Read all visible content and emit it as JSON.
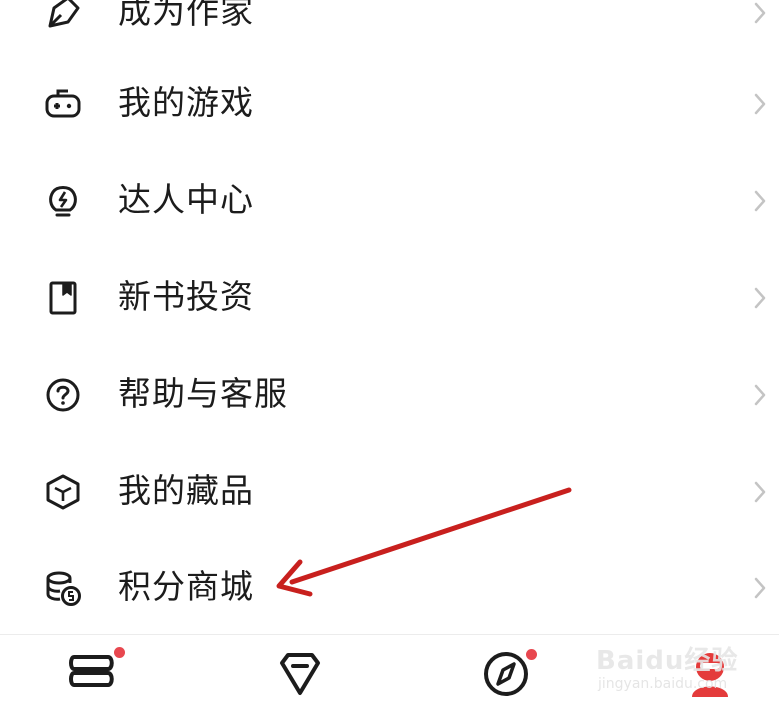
{
  "menu": {
    "items": [
      {
        "label": "成为作家",
        "icon": "pen-nib-icon"
      },
      {
        "label": "我的游戏",
        "icon": "gamepad-icon"
      },
      {
        "label": "达人中心",
        "icon": "lightbulb-bolt-icon"
      },
      {
        "label": "新书投资",
        "icon": "bookmark-book-icon"
      },
      {
        "label": "帮助与客服",
        "icon": "help-circle-icon"
      },
      {
        "label": "我的藏品",
        "icon": "cube-icon"
      },
      {
        "label": "积分商城",
        "icon": "coins-icon"
      }
    ]
  },
  "tabbar": {
    "tabs": [
      {
        "icon": "bookshelf-icon",
        "has_dot": true
      },
      {
        "icon": "diamond-icon",
        "has_dot": false
      },
      {
        "icon": "compass-icon",
        "has_dot": true
      },
      {
        "icon": "profile-icon",
        "has_dot": false
      }
    ]
  },
  "watermark": {
    "brand": "Baidu经验",
    "sub": "jingyan.baidu.com"
  },
  "colors": {
    "text": "#1c1c1c",
    "chevron": "#c4c4c4",
    "badge": "#e8474f",
    "arrow": "#c8201e"
  }
}
